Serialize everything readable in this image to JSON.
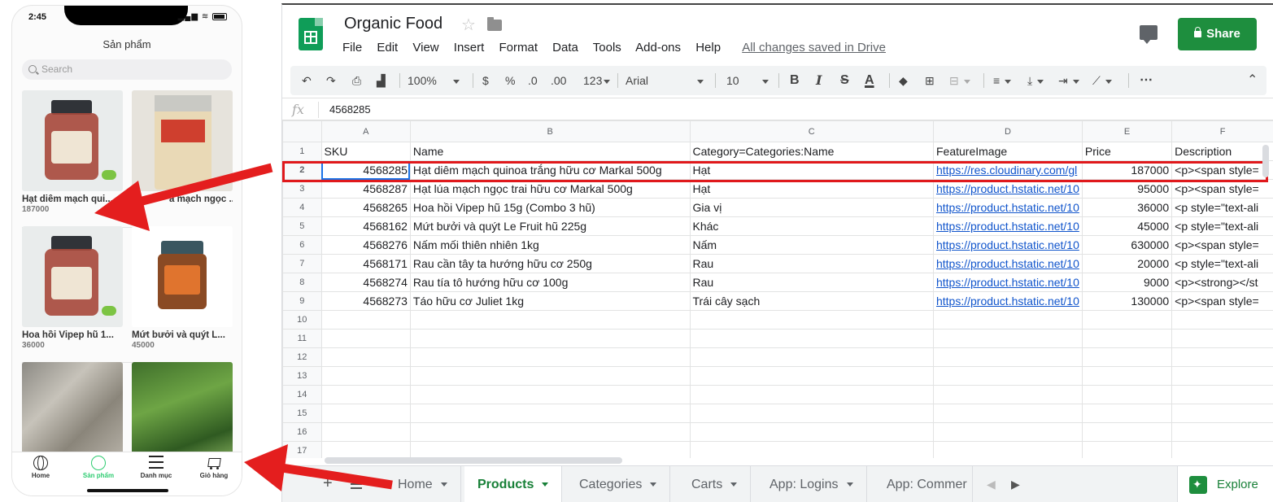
{
  "phone": {
    "status_time": "2:45",
    "title": "Sản phẩm",
    "search_placeholder": "Search",
    "products": [
      {
        "name": "Hạt diêm mạch qui...",
        "price": "187000"
      },
      {
        "name": "a mạch ngọc ...",
        "price": ""
      },
      {
        "name": "Hoa hồi Vipep hũ 1...",
        "price": "36000"
      },
      {
        "name": "Mứt bưởi và quýt L...",
        "price": "45000"
      },
      {
        "name": "",
        "price": ""
      },
      {
        "name": "",
        "price": ""
      }
    ],
    "tabs": [
      {
        "label": "Home",
        "icon": "globe-icon"
      },
      {
        "label": "Sản phẩm",
        "icon": "circle-icon"
      },
      {
        "label": "Danh mục",
        "icon": "menu-icon"
      },
      {
        "label": "Giỏ hàng",
        "icon": "cart-icon"
      }
    ]
  },
  "sheets": {
    "title": "Organic Food",
    "menu": [
      "File",
      "Edit",
      "View",
      "Insert",
      "Format",
      "Data",
      "Tools",
      "Add-ons",
      "Help"
    ],
    "saved_status": "All changes saved in Drive",
    "share_label": "Share",
    "toolbar": {
      "zoom": "100%",
      "currency": "$",
      "percent": "%",
      "dec_less": ".0",
      "dec_more": ".00",
      "more_formats": "123",
      "font": "Arial",
      "font_size": "10",
      "bold": "B",
      "italic": "I",
      "strike": "S",
      "text_color": "A",
      "more": "⋯"
    },
    "formula_value": "4568285",
    "columns": [
      "A",
      "B",
      "C",
      "D",
      "E",
      "F"
    ],
    "rows": [
      {
        "n": "1",
        "sku": "SKU",
        "name": "Name",
        "category": "Category=Categories:Name",
        "image": "FeatureImage",
        "price": "Price",
        "desc": "Description"
      },
      {
        "n": "2",
        "sku": "4568285",
        "name": "Hạt diêm mạch quinoa trắng hữu cơ Markal 500g",
        "category": "Hạt",
        "image": "https://res.cloudinary.com/gl",
        "price": "187000",
        "desc": "<p><span style="
      },
      {
        "n": "3",
        "sku": "4568287",
        "name": "Hạt lúa mạch ngọc trai hữu cơ Markal 500g",
        "category": "Hạt",
        "image": "https://product.hstatic.net/10",
        "price": "95000",
        "desc": "<p><span style="
      },
      {
        "n": "4",
        "sku": "4568265",
        "name": "Hoa hồi Vipep hũ 15g (Combo 3 hũ)",
        "category": "Gia vị",
        "image": "https://product.hstatic.net/10",
        "price": "36000",
        "desc": "<p style=\"text-ali"
      },
      {
        "n": "5",
        "sku": "4568162",
        "name": "Mứt bưởi và quýt Le Fruit hũ 225g",
        "category": "Khác",
        "image": "https://product.hstatic.net/10",
        "price": "45000",
        "desc": "<p style=\"text-ali"
      },
      {
        "n": "6",
        "sku": "4568276",
        "name": "Nấm mối thiên nhiên 1kg",
        "category": "Nấm",
        "image": "https://product.hstatic.net/10",
        "price": "630000",
        "desc": "<p><span style="
      },
      {
        "n": "7",
        "sku": "4568171",
        "name": "Rau cần tây ta hướng hữu cơ 250g",
        "category": "Rau",
        "image": "https://product.hstatic.net/10",
        "price": "20000",
        "desc": "<p style=\"text-ali"
      },
      {
        "n": "8",
        "sku": "4568274",
        "name": "Rau tía tô hướng hữu cơ 100g",
        "category": "Rau",
        "image": "https://product.hstatic.net/10",
        "price": "9000",
        "desc": "<p><strong></st"
      },
      {
        "n": "9",
        "sku": "4568273",
        "name": "Táo hữu cơ Juliet 1kg",
        "category": "Trái cây sạch",
        "image": "https://product.hstatic.net/10",
        "price": "130000",
        "desc": "<p><span style="
      },
      {
        "n": "10",
        "sku": "",
        "name": "",
        "category": "",
        "image": "",
        "price": "",
        "desc": ""
      },
      {
        "n": "11",
        "sku": "",
        "name": "",
        "category": "",
        "image": "",
        "price": "",
        "desc": ""
      },
      {
        "n": "12",
        "sku": "",
        "name": "",
        "category": "",
        "image": "",
        "price": "",
        "desc": ""
      },
      {
        "n": "13",
        "sku": "",
        "name": "",
        "category": "",
        "image": "",
        "price": "",
        "desc": ""
      },
      {
        "n": "14",
        "sku": "",
        "name": "",
        "category": "",
        "image": "",
        "price": "",
        "desc": ""
      },
      {
        "n": "15",
        "sku": "",
        "name": "",
        "category": "",
        "image": "",
        "price": "",
        "desc": ""
      },
      {
        "n": "16",
        "sku": "",
        "name": "",
        "category": "",
        "image": "",
        "price": "",
        "desc": ""
      },
      {
        "n": "17",
        "sku": "",
        "name": "",
        "category": "",
        "image": "",
        "price": "",
        "desc": ""
      }
    ],
    "sheet_tabs": [
      "Home",
      "Products",
      "Categories",
      "Carts",
      "App: Logins",
      "App: Commer"
    ],
    "active_tab": "Products",
    "explore_label": "Explore",
    "colors": {
      "brand_green": "#1e8e3e",
      "link": "#1155cc",
      "highlight_red": "#e0191c",
      "arrow_red": "#e41e1e",
      "phone_active": "#2ecc71"
    }
  }
}
